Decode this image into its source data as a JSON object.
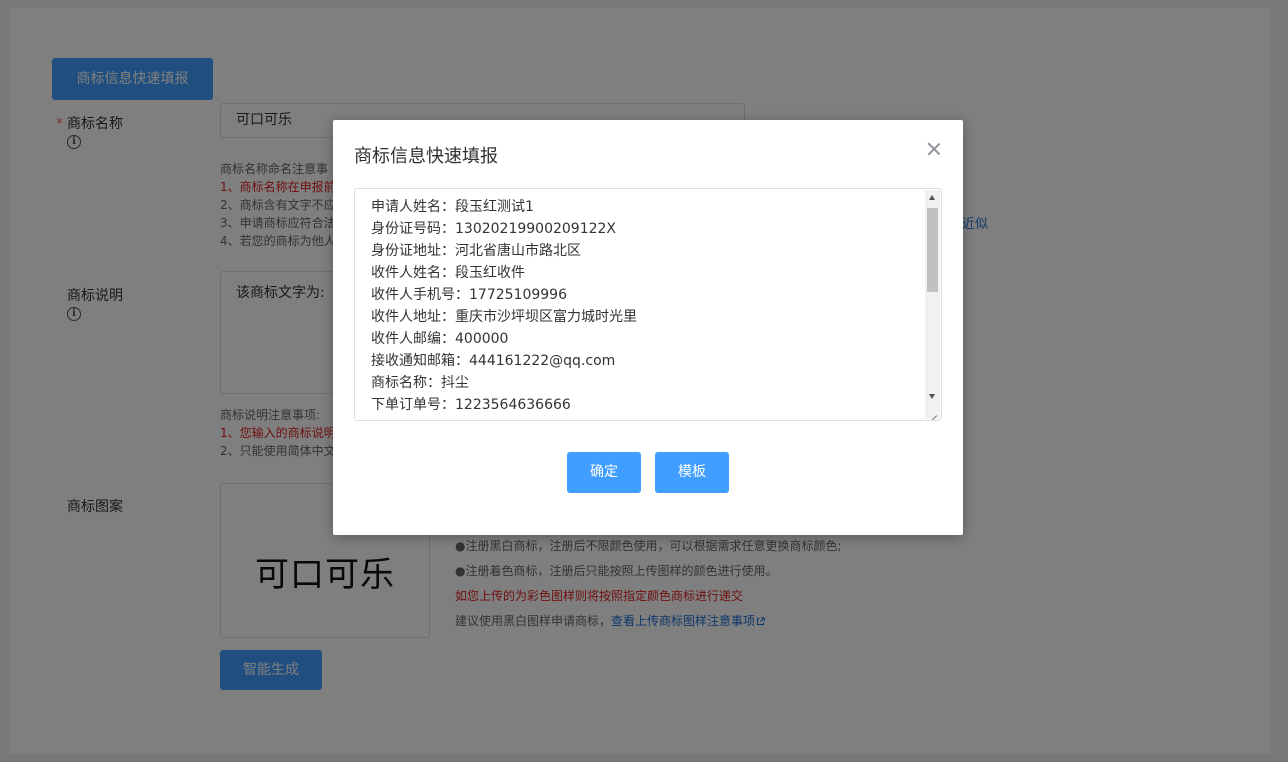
{
  "form": {
    "quick_fill_button": "商标信息快速填报",
    "name_label": "商标名称",
    "required_mark": "*",
    "info_glyph": "i",
    "name_value": "可口可乐",
    "name_notes": {
      "heading": "商标名称命名注意事",
      "line1": "1、商标名称在申报前",
      "line2": "2、商标含有文字不应",
      "line3": "3、申请商标应符合法",
      "line4": "4、若您的商标为他人",
      "link_fragment": "近似"
    },
    "desc_label": "商标说明",
    "desc_value": "该商标文字为:",
    "desc_notes": {
      "heading": "商标说明注意事项:",
      "line1": "1、您输入的商标说明",
      "line2": "2、只能使用简体中文"
    },
    "logo_label": "商标图案",
    "logo_text": "可口可乐",
    "logo_tips": {
      "tip1": "●注册黑白商标，注册后不限颜色使用，可以根据需求任意更换商标颜色;",
      "tip2": "●注册着色商标，注册后只能按照上传图样的颜色进行使用。",
      "tip3": "如您上传的为彩色图样则将按照指定颜色商标进行递交",
      "tip4_prefix": "建议使用黑白图样申请商标，",
      "tip4_link": "查看上传商标图样注意事项"
    },
    "generate_button": "智能生成"
  },
  "dialog": {
    "title": "商标信息快速填报",
    "lines": [
      "申请人姓名：段玉红测试1",
      "身份证号码：13020219900209122X",
      "身份证地址：河北省唐山市路北区",
      "收件人姓名：段玉红收件",
      "收件人手机号：17725109996",
      "收件人地址：重庆市沙坪坝区富力城时光里",
      "收件人邮编：400000",
      "接收通知邮箱：444161222@qq.com",
      "商标名称：抖尘",
      "下单订单号：1223564636666"
    ],
    "confirm_button": "确定",
    "template_button": "模板"
  },
  "colors": {
    "primary": "#409eff",
    "required": "#f56c6c",
    "warning_text": "#e02020",
    "link": "#1a6fd6",
    "overlay": "rgba(0,0,0,0.5)"
  }
}
